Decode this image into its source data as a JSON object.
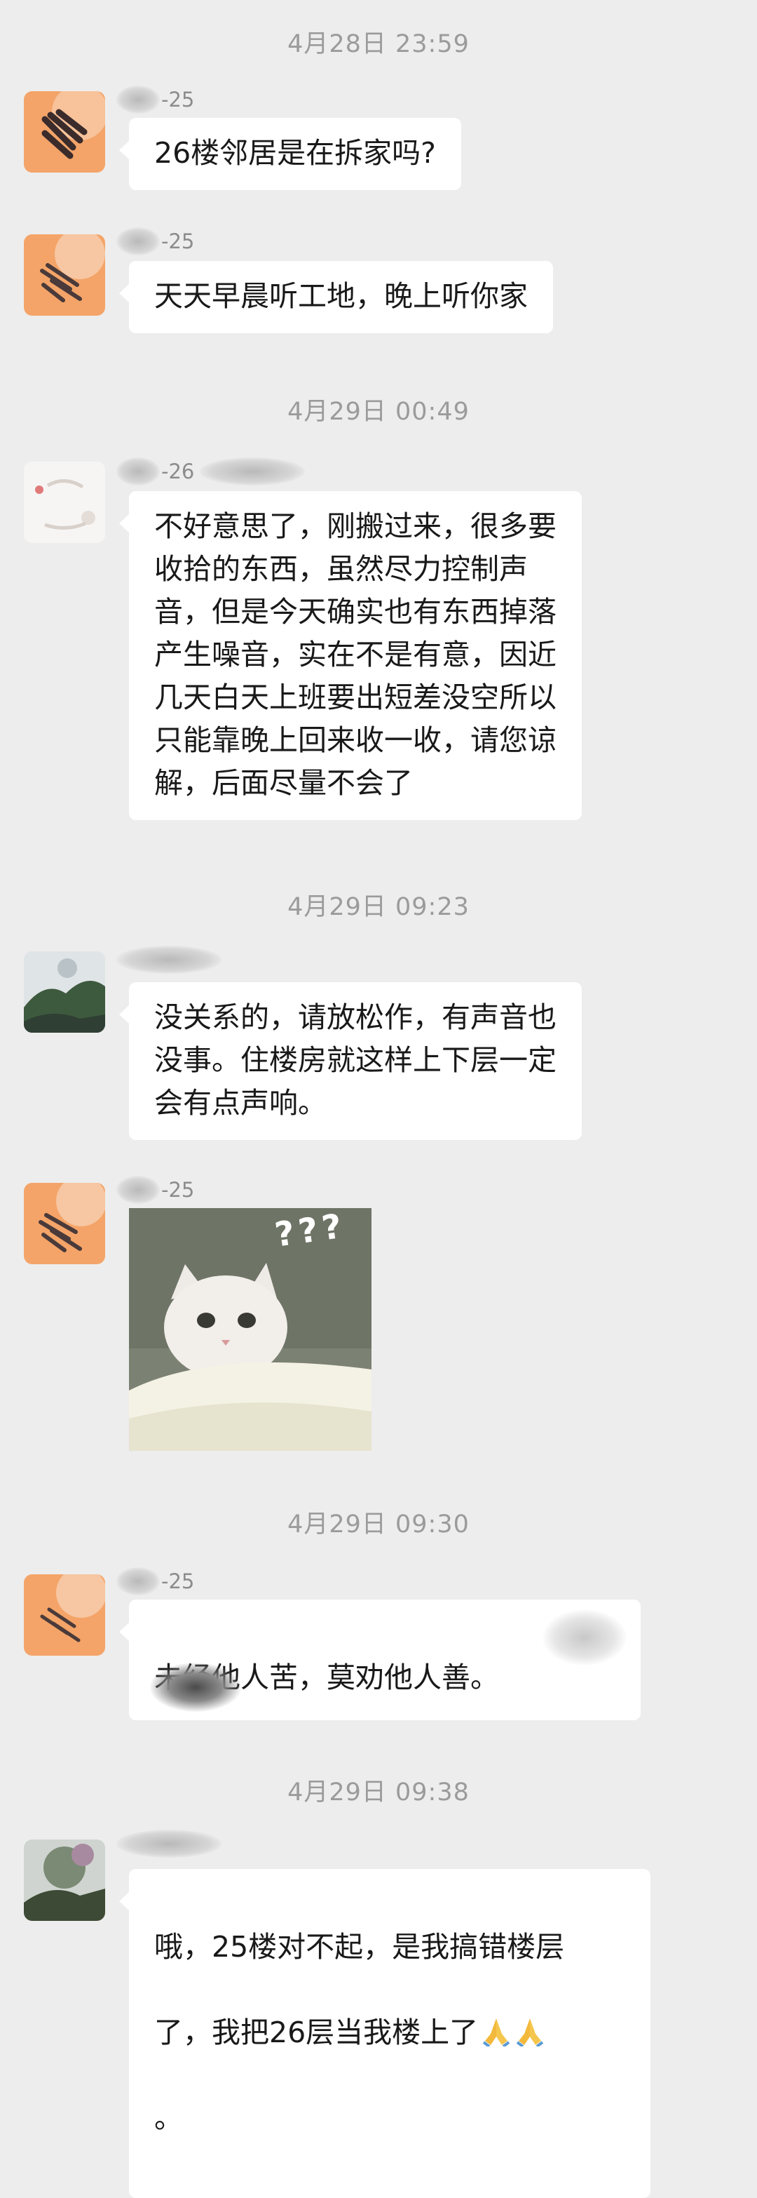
{
  "chat": {
    "messages": [
      {
        "time": "4月28日 23:59",
        "sender": "-25",
        "text": "26楼邻居是在拆家吗?"
      },
      {
        "sender": "-25",
        "text": "天天早晨听工地，晚上听你家"
      },
      {
        "time": "4月29日 00:49",
        "sender": "-26",
        "text": "不好意思了，刚搬过来，很多要\n收拾的东西，虽然尽力控制声\n音，但是今天确实也有东西掉落\n产生噪音，实在不是有意，因近\n几天白天上班要出短差没空所以\n只能靠晚上回来收一收，请您谅\n解，后面尽量不会了"
      },
      {
        "time": "4月29日 09:23",
        "sender": "",
        "text": "没关系的，请放松作，有声音也\n没事。住楼房就这样上下层一定\n会有点声响。"
      },
      {
        "sender": "-25",
        "sticker": "cat-question-sticker",
        "sticker_text": "???"
      },
      {
        "time": "4月29日 09:30",
        "sender": "-25",
        "text": "未经他人苦，莫劝他人善。"
      },
      {
        "time": "4月29日 09:38",
        "sender": "",
        "text_line1": "哦，25楼对不起，是我搞错楼层",
        "text_line2": "了，我把26层当我楼上了",
        "text_line3": "。",
        "emoji": "folded-hands-emoji"
      }
    ]
  },
  "colors": {
    "background": "#ededed",
    "bubble": "#ffffff",
    "timestamp": "#9b9b9b",
    "text": "#191919"
  }
}
